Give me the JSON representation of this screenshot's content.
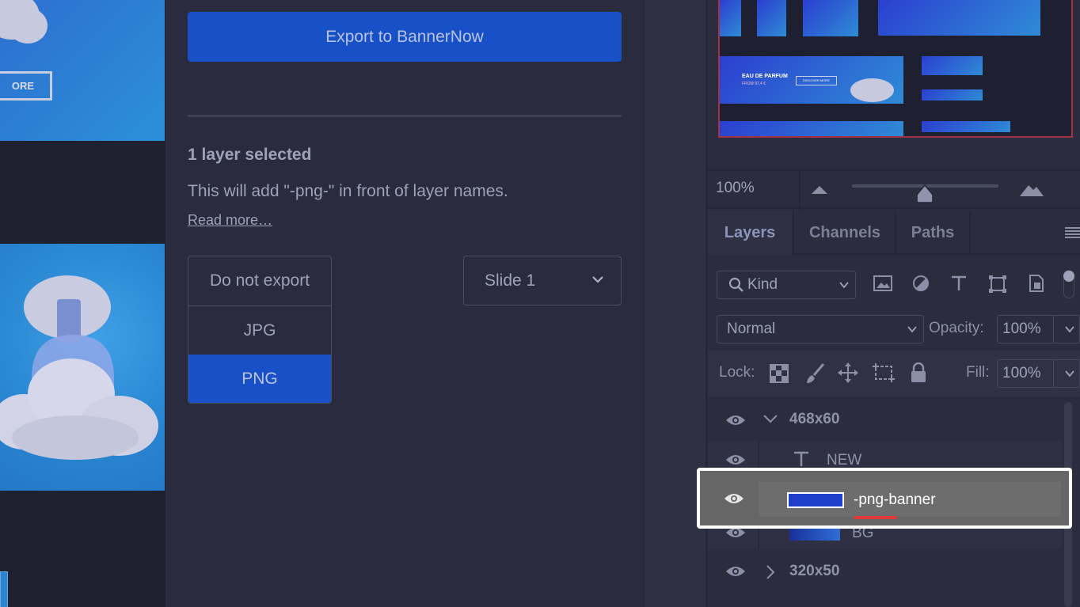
{
  "canvas": {
    "more_button_text": "ORE"
  },
  "export_panel": {
    "export_button": "Export to BannerNow",
    "selection_count": "1 layer selected",
    "description": "This will add \"-png-\" in front of layer names.",
    "read_more": "Read more…",
    "formats": [
      "Do not export",
      "JPG",
      "PNG"
    ],
    "selected_format": "PNG",
    "slide_select": "Slide 1",
    "accent_color": "#1750c7"
  },
  "navigator": {
    "zoom": "100%",
    "thumb_texts": {
      "eau_de_parfum": "EAU DE PARFUM",
      "from_price": "FROM 97,4 €",
      "discover_more": "DISCOVER MORE",
      "discover": "DISCOVER"
    }
  },
  "layers_panel": {
    "tabs": [
      "Layers",
      "Channels",
      "Paths"
    ],
    "active_tab": "Layers",
    "filter_kind": "Kind",
    "blend_mode": "Normal",
    "opacity_label": "Opacity:",
    "opacity_value": "100%",
    "lock_label": "Lock:",
    "fill_label": "Fill:",
    "fill_value": "100%",
    "layers": [
      {
        "name": "468x60",
        "type": "group",
        "expanded": true,
        "visible": true
      },
      {
        "name": "NEW",
        "type": "text",
        "visible": true
      },
      {
        "name": "-png-banner",
        "type": "smart-object",
        "visible": true,
        "selected": true
      },
      {
        "name": "BG",
        "type": "image",
        "visible": true
      },
      {
        "name": "320x50",
        "type": "group",
        "expanded": false,
        "visible": true
      }
    ]
  }
}
